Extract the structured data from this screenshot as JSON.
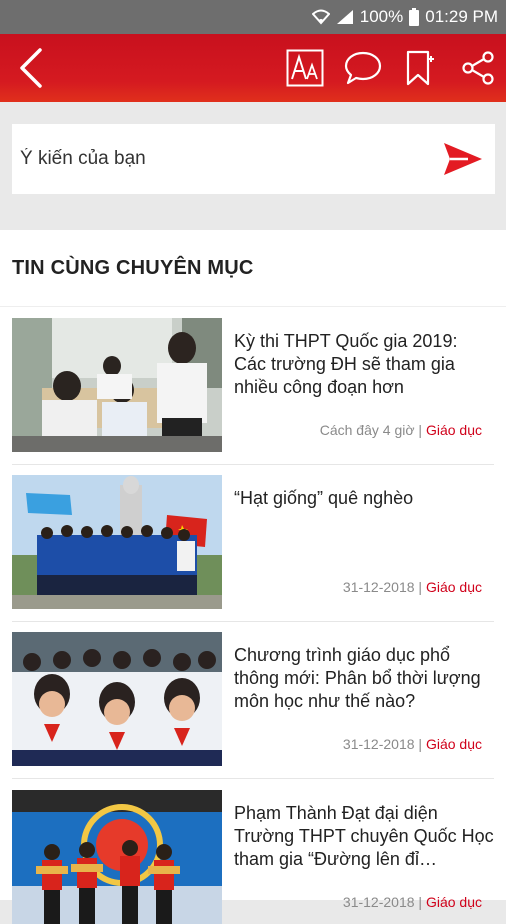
{
  "status": {
    "battery": "100%",
    "time": "01:29 PM"
  },
  "toolbar": {
    "icons": [
      "back-arrow-icon",
      "font-size-icon",
      "comment-icon",
      "bookmark-icon",
      "share-icon"
    ]
  },
  "comment": {
    "placeholder": "Ý kiến của bạn"
  },
  "section": {
    "title": "TIN CÙNG CHUYÊN MỤC"
  },
  "articles": [
    {
      "title": "Kỳ thi THPT Quốc gia 2019: Các trường ĐH sẽ tham gia nhiều công đoạn hơn",
      "time": "Cách đây 4 giờ",
      "category": "Giáo dục"
    },
    {
      "title": "“Hạt giống” quê nghèo",
      "time": "31-12-2018",
      "category": "Giáo dục"
    },
    {
      "title": "Chương trình giáo dục phổ thông mới: Phân bổ thời lượng môn học như thế nào?",
      "time": "31-12-2018",
      "category": "Giáo dục"
    },
    {
      "title": "Phạm Thành Đạt đại diện Trường THPT chuyên Quốc Học tham gia “Đường lên đỉ…",
      "time": "31-12-2018",
      "category": "Giáo dục"
    }
  ],
  "colors": {
    "brand": "#d51a20",
    "category": "#d0021b"
  }
}
